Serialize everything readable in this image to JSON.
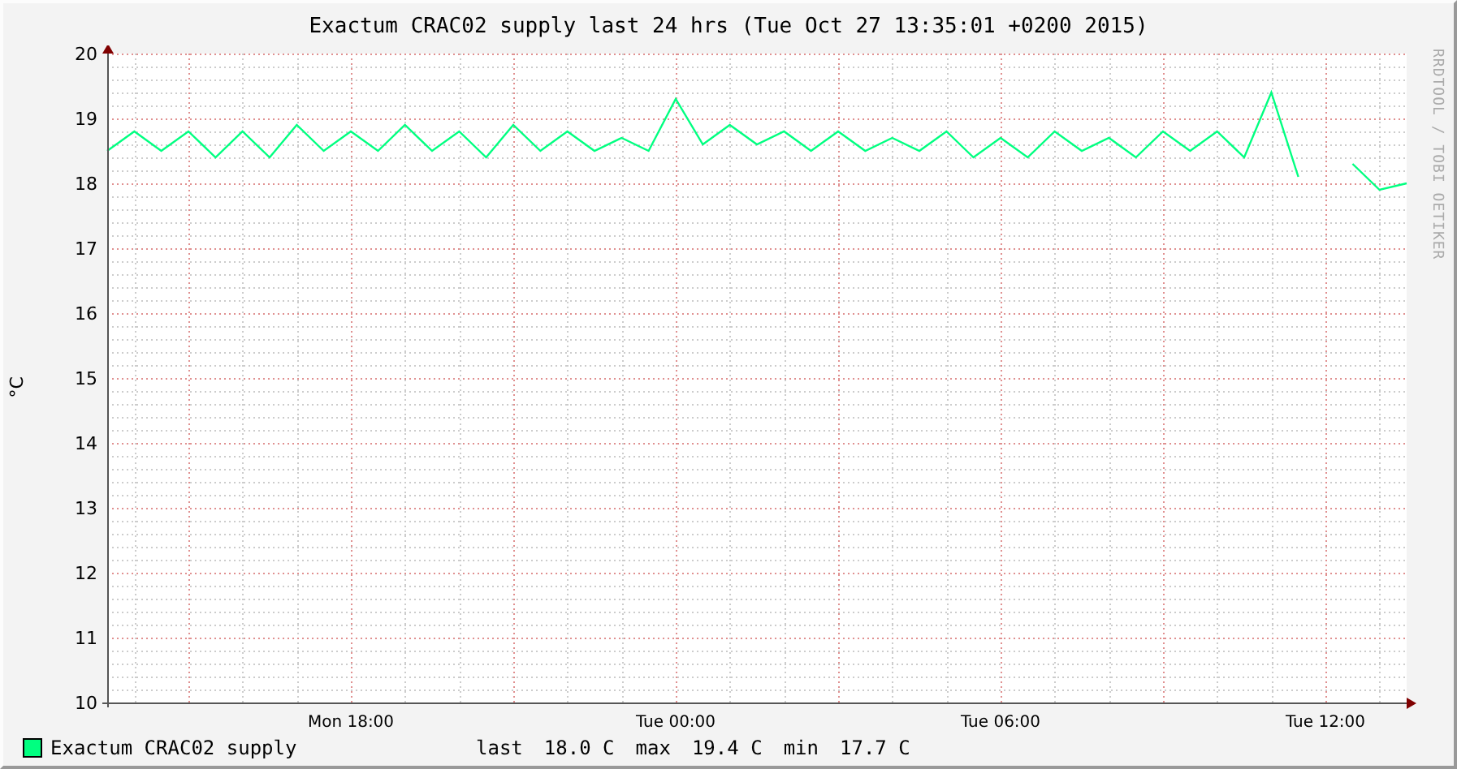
{
  "graph": {
    "title": "Exactum CRAC02 supply last 24 hrs (Tue Oct 27 13:35:01 +0200 2015)",
    "side_text": "RRDTOOL / TOBI OETIKER",
    "chart_data": {
      "type": "line",
      "grid": true,
      "ylabel": "°C",
      "ylim": [
        10,
        20
      ],
      "categories": [
        null,
        null,
        null,
        null,
        null,
        null,
        null,
        null,
        null,
        "Mon 18:00",
        null,
        null,
        null,
        null,
        null,
        null,
        null,
        null,
        null,
        null,
        null,
        "Tue 00:00",
        null,
        null,
        null,
        null,
        null,
        null,
        null,
        null,
        null,
        null,
        null,
        "Tue 06:00",
        null,
        null,
        null,
        null,
        null,
        null,
        null,
        null,
        null,
        null,
        null,
        "Tue 12:00",
        null,
        null,
        null
      ],
      "yticks": [
        10,
        11,
        12,
        13,
        14,
        15,
        16,
        17,
        18,
        19,
        20
      ],
      "series": [
        {
          "name": "Exactum CRAC02 supply",
          "color": "#00ff80",
          "values": [
            18.5,
            18.8,
            18.5,
            18.8,
            18.4,
            18.8,
            18.4,
            18.9,
            18.5,
            18.8,
            18.5,
            18.9,
            18.5,
            18.8,
            18.4,
            18.9,
            18.5,
            18.8,
            18.5,
            18.7,
            18.5,
            19.3,
            18.6,
            18.9,
            18.6,
            18.8,
            18.5,
            18.8,
            18.5,
            18.7,
            18.5,
            18.8,
            18.4,
            18.7,
            18.4,
            18.8,
            18.5,
            18.7,
            18.4,
            18.8,
            18.5,
            18.8,
            18.4,
            19.4,
            18.1,
            null,
            18.3,
            17.9,
            18.0
          ]
        }
      ]
    },
    "legend_stats": [
      {
        "label": "last",
        "value": "18.0 C"
      },
      {
        "label": "max",
        "value": "19.4 C"
      },
      {
        "label": "min",
        "value": "17.7 C"
      }
    ]
  }
}
